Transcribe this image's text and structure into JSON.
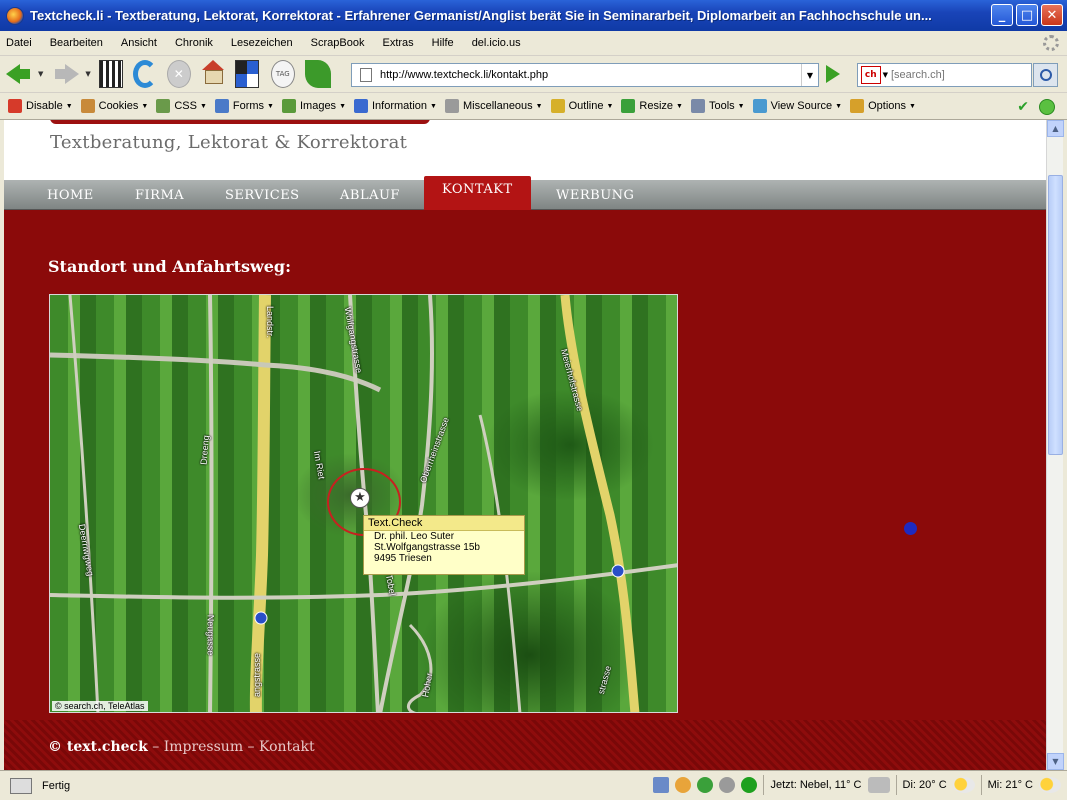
{
  "window": {
    "title": "Textcheck.li - Textberatung, Lektorat, Korrektorat - Erfahrener Germanist/Anglist berät Sie in Seminararbeit, Diplomarbeit an Fachhochschule un...",
    "minimize": "_",
    "maximize": "□",
    "close": "✕"
  },
  "menu": [
    "Datei",
    "Bearbeiten",
    "Ansicht",
    "Chronik",
    "Lesezeichen",
    "ScrapBook",
    "Extras",
    "Hilfe",
    "del.icio.us"
  ],
  "navbar": {
    "url": "http://www.textcheck.li/kontakt.php",
    "search_placeholder": "[search.ch]",
    "search_engine": "ch",
    "tag_label": "TAG"
  },
  "devbar": [
    {
      "label": "Disable",
      "color": "#d63a2a"
    },
    {
      "label": "Cookies",
      "color": "#c88a3a"
    },
    {
      "label": "CSS",
      "color": "#6a9a4a"
    },
    {
      "label": "Forms",
      "color": "#4a7ac8"
    },
    {
      "label": "Images",
      "color": "#5a9a3a"
    },
    {
      "label": "Information",
      "color": "#3a6ad0"
    },
    {
      "label": "Miscellaneous",
      "color": "#9a9a9a"
    },
    {
      "label": "Outline",
      "color": "#d6b02a"
    },
    {
      "label": "Resize",
      "color": "#3aa03a"
    },
    {
      "label": "Tools",
      "color": "#7a8aa8"
    },
    {
      "label": "View Source",
      "color": "#4a9ad0"
    },
    {
      "label": "Options",
      "color": "#d6a02a"
    }
  ],
  "site": {
    "tagline": "Textberatung, Lektorat & Korrektorat",
    "nav": [
      {
        "label": "HOME",
        "active": false
      },
      {
        "label": "FIRMA",
        "active": false
      },
      {
        "label": "SERVICES",
        "active": false
      },
      {
        "label": "ABLAUF",
        "active": false
      },
      {
        "label": "KONTAKT",
        "active": true
      },
      {
        "label": "WERBUNG",
        "active": false
      }
    ],
    "section_title": "Standort und Anfahrtsweg:",
    "map": {
      "popup_title": "Text.Check",
      "popup_lines": [
        "Dr. phil. Leo Suter",
        "St.Wolfgangstrasse 15b",
        "9495 Triesen"
      ],
      "copyright": "© search.ch, TeleAtlas",
      "streets": [
        "Landstr.",
        "Wolfgangstrasse",
        "Oberrheinstrasse",
        "Meierhofstrasse",
        "Im Riet",
        "Dreeng",
        "Deerriwgweg",
        "Neugasse",
        "angstrasse",
        "Tobel",
        "Hoher",
        "strasse"
      ]
    },
    "footer": {
      "brand": "© text.check",
      "sep": "–",
      "impressum": "Impressum",
      "kontakt": "Kontakt"
    }
  },
  "status": {
    "text": "Fertig",
    "weather_now": "Jetzt: Nebel, 11° C",
    "weather_tue": "Di: 20° C",
    "weather_wed": "Mi: 21° C"
  }
}
